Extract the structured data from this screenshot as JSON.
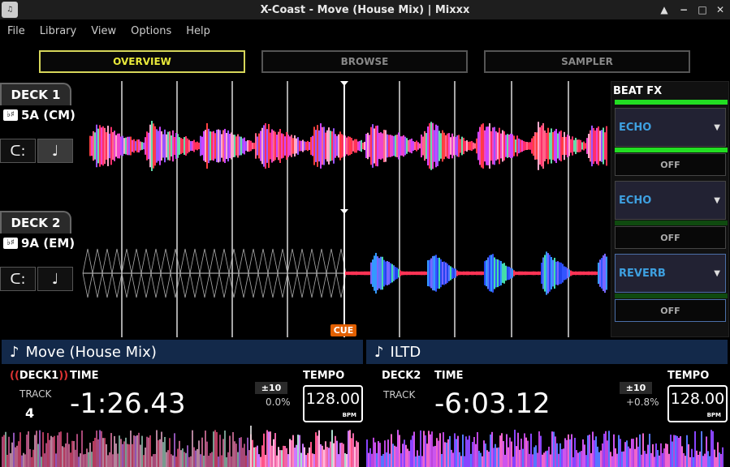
{
  "window": {
    "title": "X-Coast - Move (House Mix) | Mixxx",
    "app_icon": "mixxx-icon",
    "controls": [
      "▲",
      "−",
      "□",
      "✕"
    ]
  },
  "menu": [
    "File",
    "Library",
    "View",
    "Options",
    "Help"
  ],
  "mode_tabs": [
    {
      "label": "OVERVIEW",
      "active": true
    },
    {
      "label": "BROWSE",
      "active": false
    },
    {
      "label": "SAMPLER",
      "active": false
    }
  ],
  "decks": [
    {
      "label": "DECK 1",
      "key": "5A (CM)",
      "loop_icon": "loop-icon",
      "note_icon": "note-icon"
    },
    {
      "label": "DECK 2",
      "key": "9A (EM)",
      "loop_icon": "loop-icon",
      "note_icon": "note-icon"
    }
  ],
  "cue_label": "CUE",
  "fx": {
    "title": "BEAT FX",
    "units": [
      {
        "effect": "ECHO",
        "state": "OFF",
        "bar_color": "#22dd22"
      },
      {
        "effect": "ECHO",
        "state": "OFF",
        "bar_color": "#0f4a0f"
      },
      {
        "effect": "REVERB",
        "state": "OFF",
        "bar_color": "#0f4a0f"
      }
    ]
  },
  "deck_info": [
    {
      "track_title": "Move (House Mix)",
      "deck_tag": "DECK1",
      "track_label": "TRACK",
      "track_number": "4",
      "time_label": "TIME",
      "time": "-1:26.43",
      "range": "±10",
      "pitch": "0.0%",
      "tempo_label": "TEMPO",
      "bpm": "128.00",
      "bpm_unit": "BPM"
    },
    {
      "track_title": "ILTD",
      "deck_tag": "DECK2",
      "track_label": "TRACK",
      "track_number": "",
      "time_label": "TIME",
      "time": "-6:03.12",
      "range": "±10",
      "pitch": "+0.8%",
      "tempo_label": "TEMPO",
      "bpm": "128.00",
      "bpm_unit": "BPM"
    }
  ],
  "colors": {
    "accent": "#e8e83a",
    "header_blue": "#13294a",
    "fx_active": "#22dd22",
    "cue": "#e25f00"
  }
}
